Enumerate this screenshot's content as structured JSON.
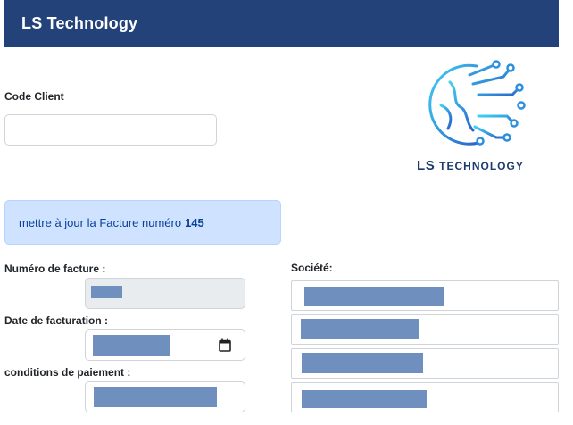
{
  "navbar": {
    "brand": "LS Technology"
  },
  "logo": {
    "primary": "LS",
    "secondary": "TECHNOLOGY"
  },
  "form": {
    "code_client_label": "Code Client",
    "code_client_value": "",
    "numero_label": "Numéro de facture :",
    "date_label": "Date de facturation :",
    "conditions_label": "conditions de paiement :",
    "societe_label": "Société:"
  },
  "alert": {
    "text": "mettre à jour la Facture numéro",
    "number": "145"
  },
  "icons": {
    "calendar": "calendar-icon",
    "logo": "globe-circuit-icon"
  },
  "colors": {
    "navbar": "#23427a",
    "alert_bg": "#cfe2ff",
    "alert_text": "#084298",
    "redaction": "#6f8fbf"
  }
}
